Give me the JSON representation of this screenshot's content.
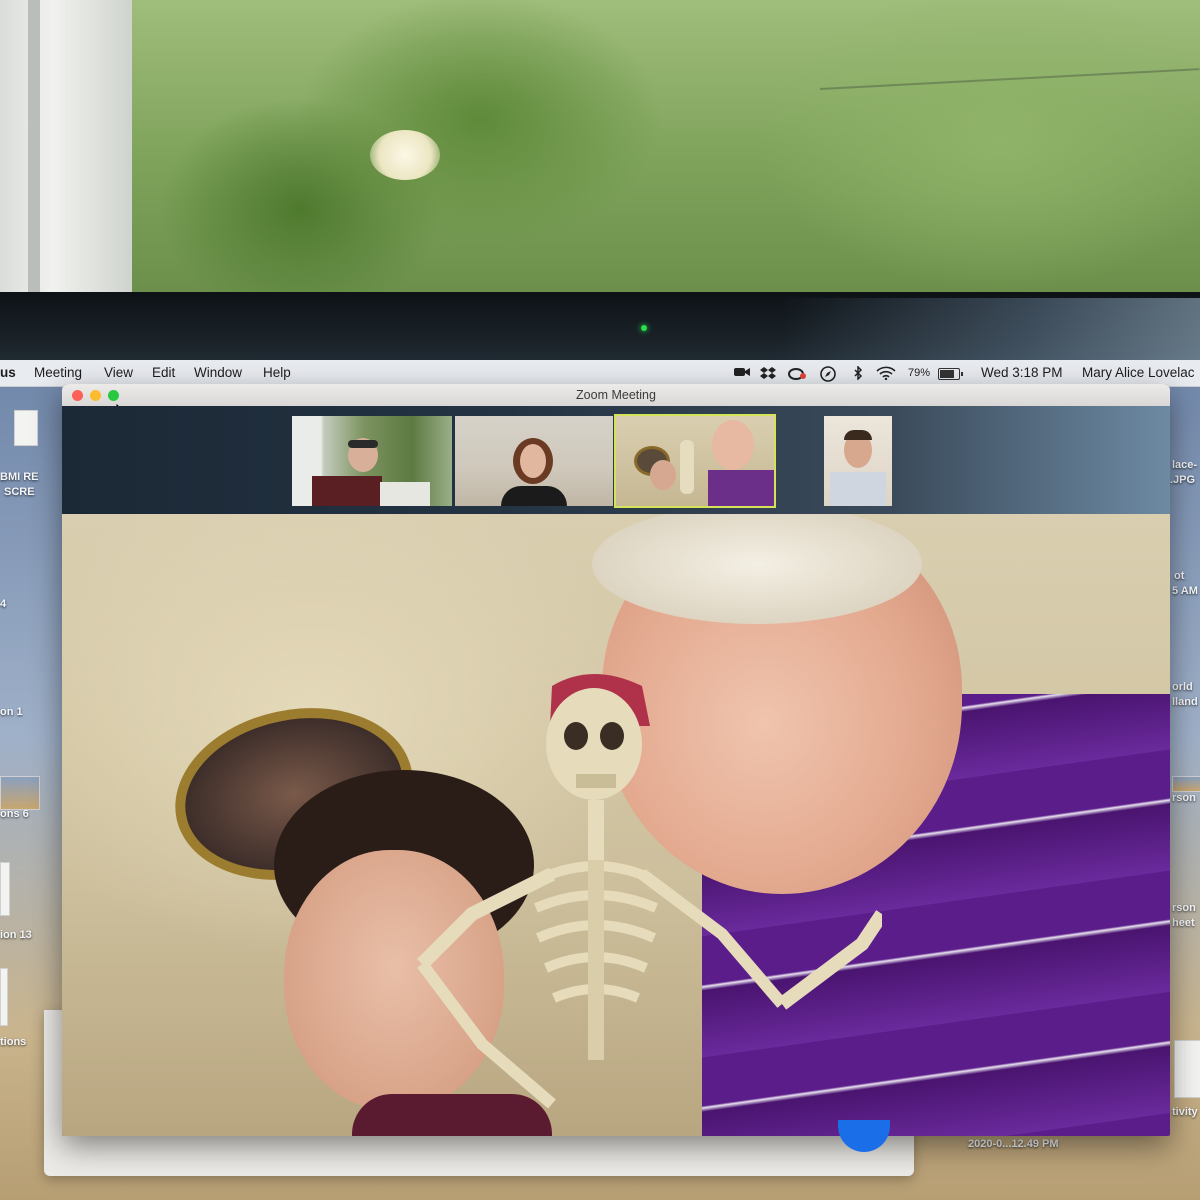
{
  "menubar": {
    "app_fragment": "us",
    "menus": [
      "Meeting",
      "View",
      "Edit",
      "Window",
      "Help"
    ],
    "battery_percent": "79%",
    "clock": "Wed 3:18 PM",
    "user": "Mary Alice Lovelac"
  },
  "zoom": {
    "window_title": "Zoom Meeting"
  },
  "desktop": {
    "left_labels": [
      "BMI RE",
      "SCRE",
      "4",
      "on 1",
      "ons 6",
      "ion 13",
      "tions"
    ],
    "right_labels": [
      "lace-",
      ".JPG",
      "ot",
      "5 AM",
      "orld",
      "lland",
      "rson",
      "rson",
      "heet",
      "tivity"
    ],
    "bottom_label": "2020-0...12.49 PM"
  },
  "colors": {
    "active_speaker_outline": "#d6e25a",
    "close": "#fc5f57",
    "minimize": "#fdbc2e",
    "zoom": "#28c840",
    "accent_blue": "#1a6ee8"
  },
  "icons": [
    "video-camera-icon",
    "dropbox-icon",
    "creative-cloud-icon",
    "safari-icon",
    "bluetooth-icon",
    "wifi-icon",
    "battery-icon",
    "mouse-cursor-icon"
  ]
}
